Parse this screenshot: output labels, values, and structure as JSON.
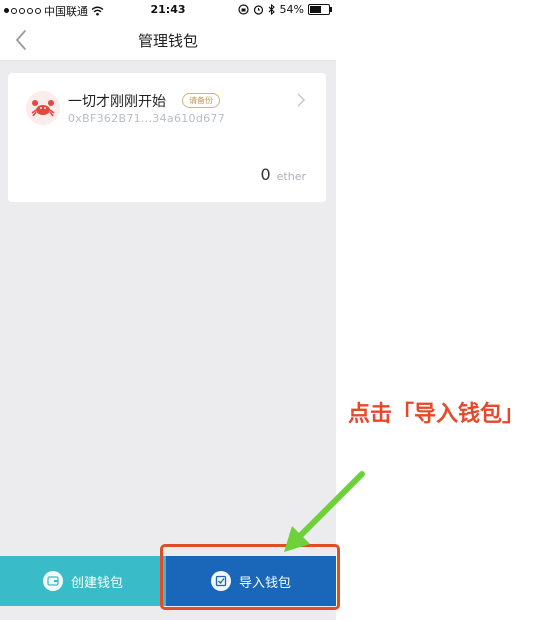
{
  "status_bar": {
    "carrier": "中国联通",
    "time": "21:43",
    "battery": "54%"
  },
  "nav": {
    "title": "管理钱包",
    "back_icon": "chevron-left-icon"
  },
  "wallet": {
    "name": "一切才刚刚开始",
    "badge": "请备份",
    "address": "0xBF362B71...34a610d677",
    "balance": "0",
    "unit": "ether",
    "avatar_icon": "crab-icon"
  },
  "bottom": {
    "create_label": "创建钱包",
    "import_label": "导入钱包"
  },
  "annotation": {
    "text": "点击「导入钱包」",
    "color": "#e7482a",
    "arrow_color": "#6fd13a"
  },
  "colors": {
    "create_bg": "#39bcc8",
    "import_bg": "#1a67b9",
    "highlight": "#e04d2b"
  }
}
